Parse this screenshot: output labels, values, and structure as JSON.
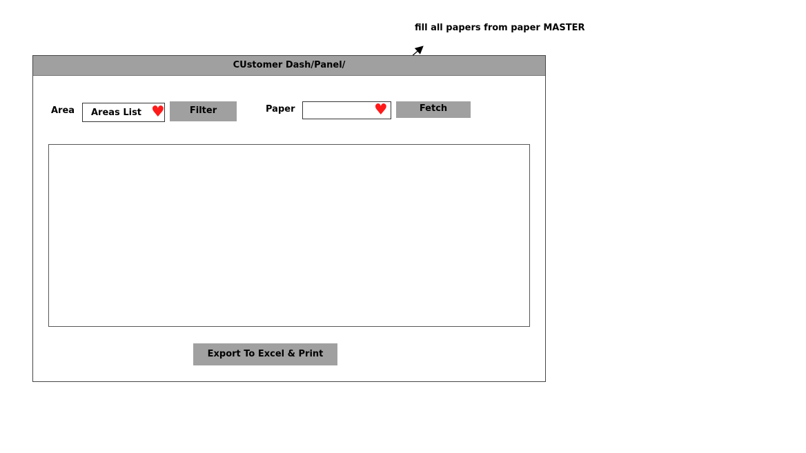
{
  "annotation": {
    "text": "fill all papers from paper MASTER"
  },
  "panel": {
    "title": "CUstomer Dash/Panel/"
  },
  "area": {
    "label": "Area",
    "select_value": "Areas List",
    "dropdown_icon": "heart-icon",
    "filter_label": "Filter"
  },
  "paper": {
    "label": "Paper",
    "select_value": "",
    "dropdown_icon": "heart-icon",
    "fetch_label": "Fetch"
  },
  "export": {
    "label": "Export To Excel & Print"
  },
  "colors": {
    "header_bg": "#a0a0a0",
    "button_bg": "#a0a0a0",
    "heart": "#ff1a1a"
  }
}
